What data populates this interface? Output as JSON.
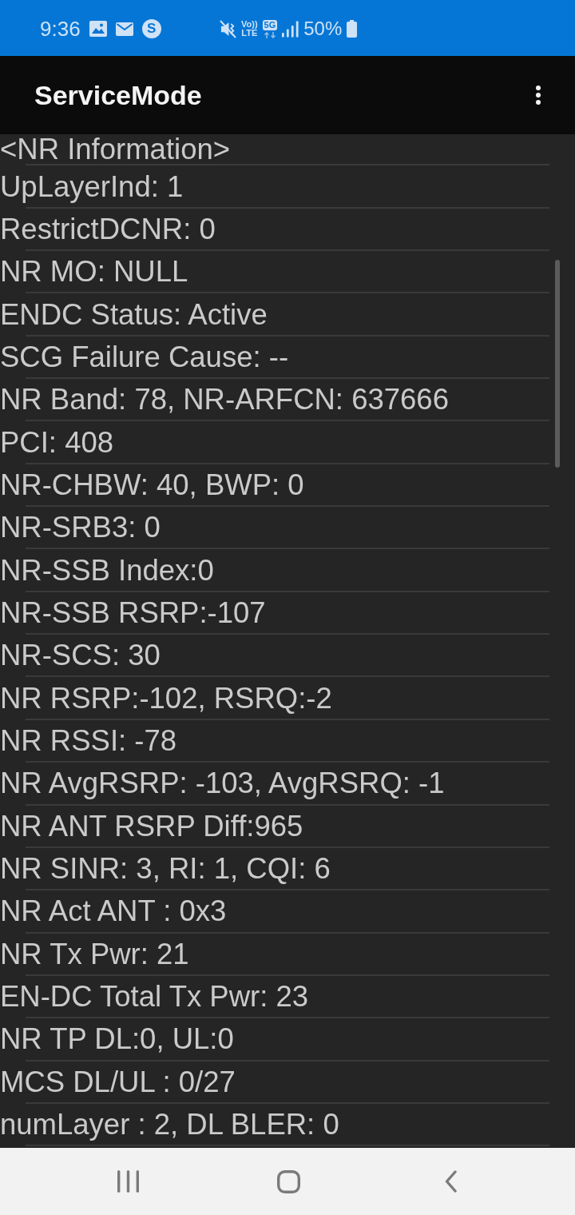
{
  "status_bar": {
    "time": "9:36",
    "notification_badge": "S",
    "volte": {
      "top": "Vo))",
      "bottom": "LTE"
    },
    "network": "5G",
    "battery": "50%"
  },
  "app_bar": {
    "title": "ServiceMode"
  },
  "rows": [
    "<NR Information>",
    "UpLayerInd: 1",
    "RestrictDCNR: 0",
    "NR MO: NULL",
    "ENDC Status: Active",
    "SCG Failure Cause: --",
    "NR Band: 78, NR-ARFCN: 637666",
    "PCI: 408",
    "NR-CHBW: 40, BWP: 0",
    "NR-SRB3: 0",
    "NR-SSB Index:0",
    "NR-SSB RSRP:-107",
    "NR-SCS: 30",
    "NR RSRP:-102, RSRQ:-2",
    "NR RSSI: -78",
    "NR AvgRSRP: -103, AvgRSRQ: -1",
    "NR ANT RSRP Diff:965",
    "NR SINR: 3, RI: 1, CQI: 6",
    "NR Act ANT : 0x3",
    "NR Tx Pwr: 21",
    "EN-DC Total Tx Pwr: 23",
    "NR TP DL:0, UL:0",
    "MCS DL/UL : 0/27",
    "numLayer : 2, DL BLER: 0"
  ]
}
